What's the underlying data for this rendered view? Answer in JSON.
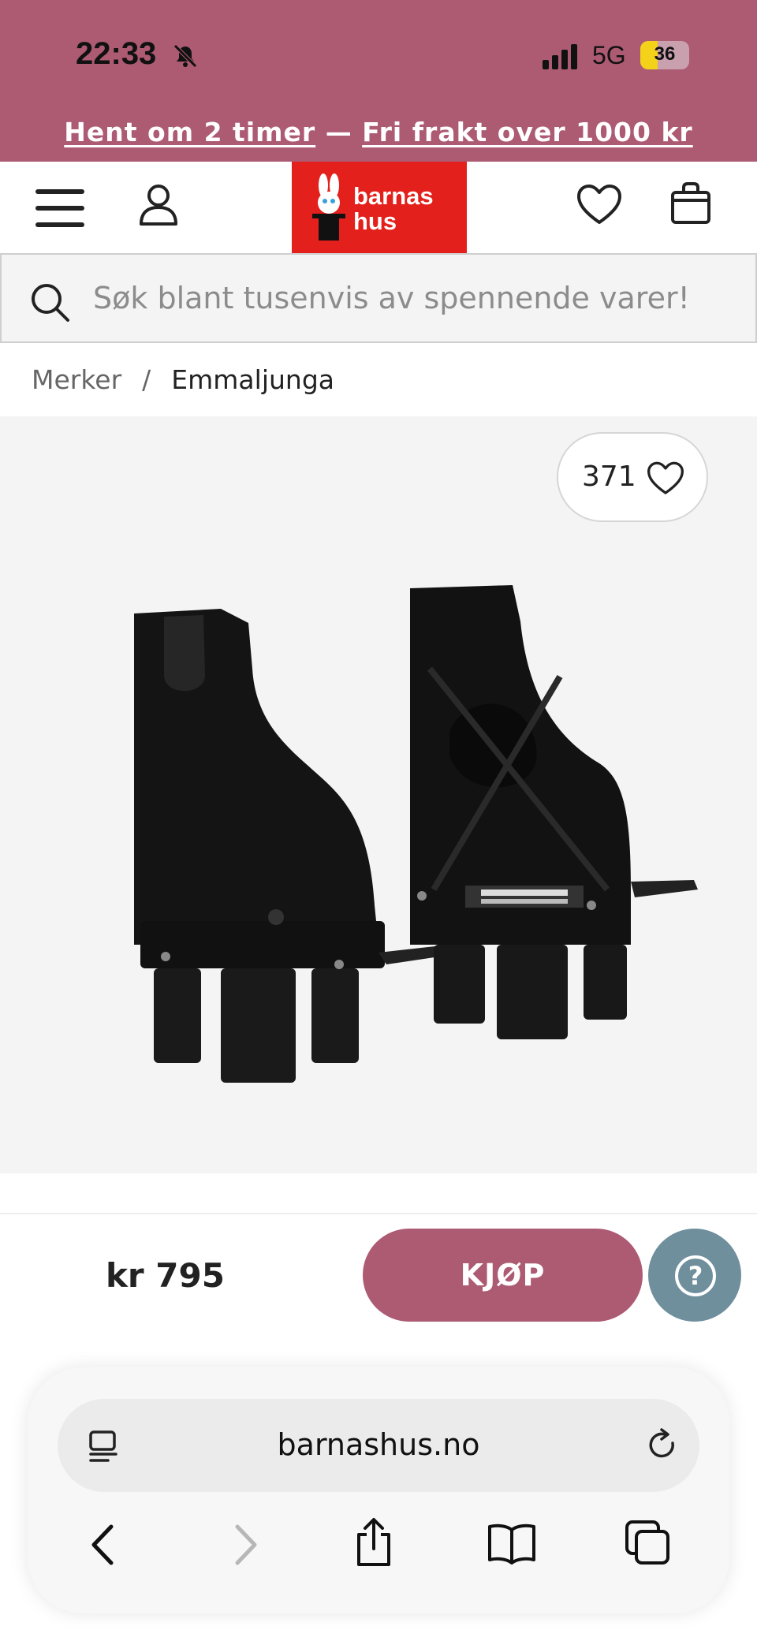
{
  "status_bar": {
    "time": "22:33",
    "network": "5G",
    "battery_level": "36",
    "battery_fraction": 0.36
  },
  "promo": {
    "pickup_text": "Hent om 2 timer",
    "separator": "—",
    "shipping_text": "Fri frakt over 1000 kr"
  },
  "header": {
    "logo_line1": "barnas",
    "logo_line2": "hus"
  },
  "search": {
    "placeholder": "Søk blant tusenvis av spennende varer!"
  },
  "breadcrumb": {
    "items": [
      "Merker",
      "Emmaljunga"
    ],
    "separator": "/"
  },
  "product": {
    "favorites_count": "371",
    "price": "kr 795",
    "buy_label": "KJØP",
    "help_label": "?"
  },
  "browser": {
    "url": "barnashus.no"
  },
  "colors": {
    "brand": "#ad5a73",
    "logo_red": "#e3201b",
    "help": "#6f8f9d"
  }
}
